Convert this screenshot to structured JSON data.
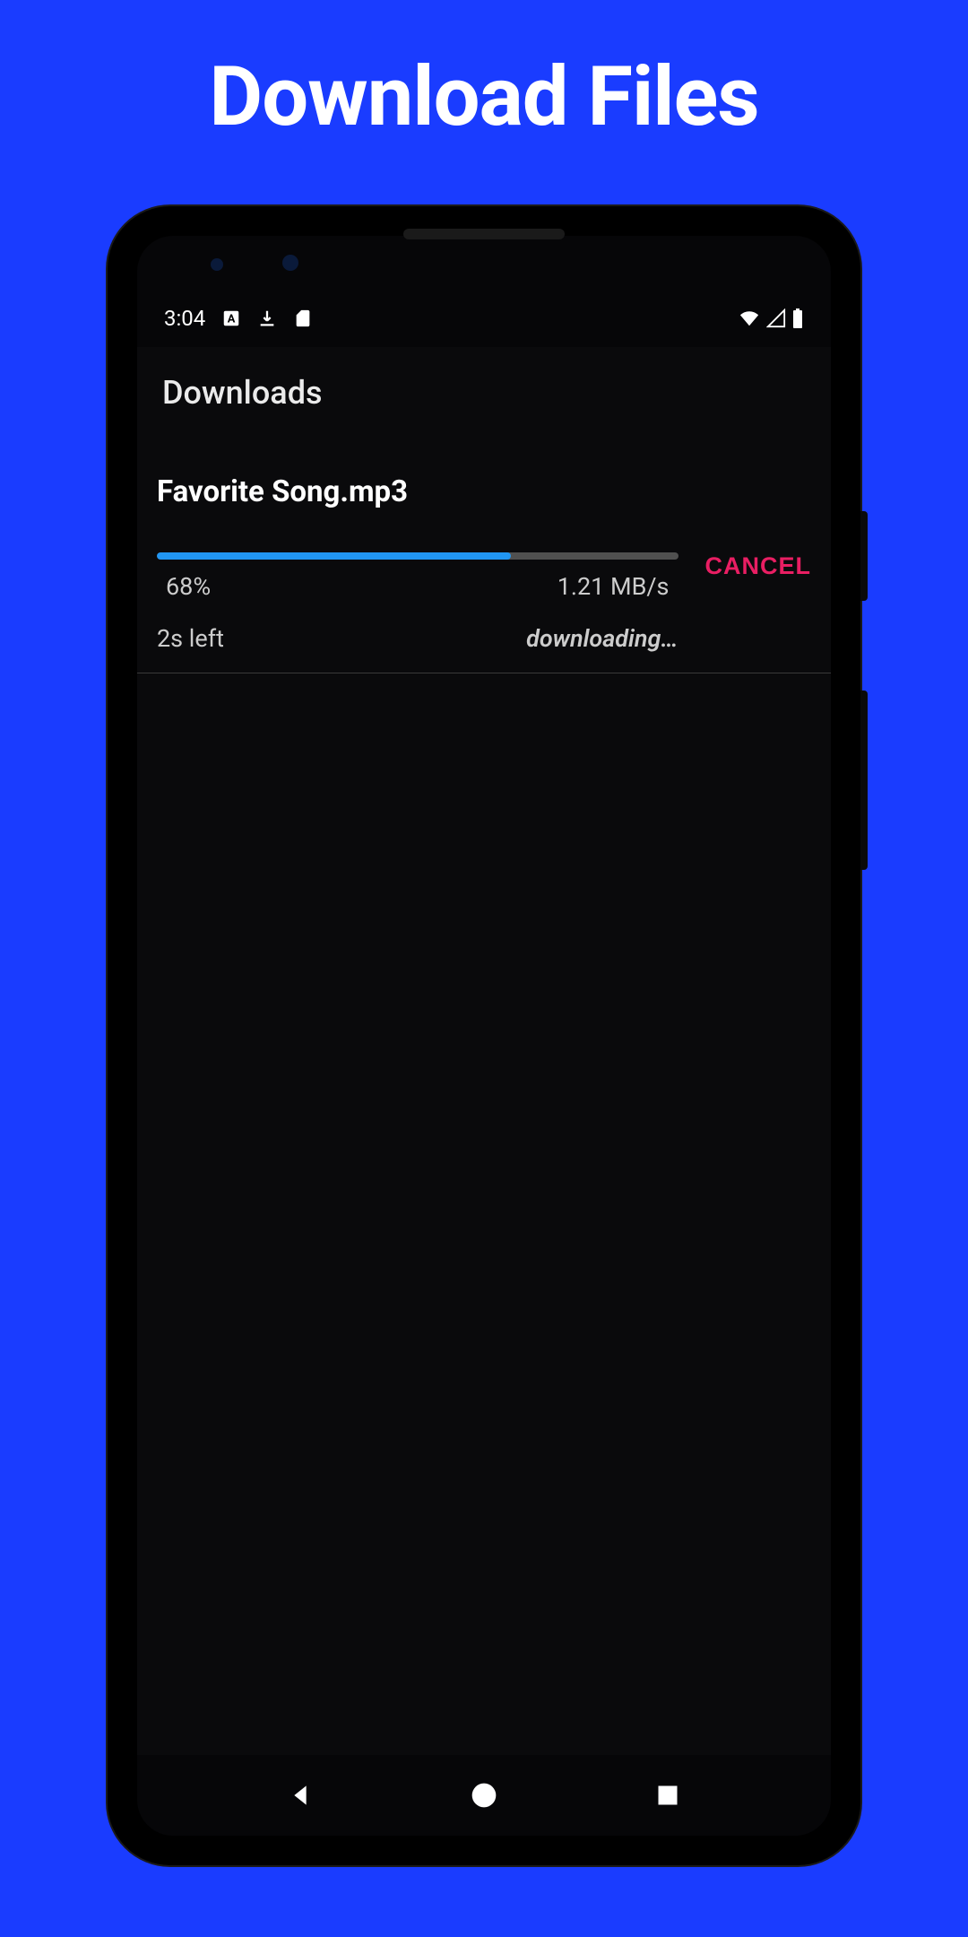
{
  "promo": {
    "title": "Download Files"
  },
  "statusBar": {
    "time": "3:04"
  },
  "app": {
    "title": "Downloads"
  },
  "download": {
    "fileName": "Favorite Song.mp3",
    "progressPercent": 68,
    "progressLabel": "68%",
    "speed": "1.21 MB/s",
    "timeLeft": "2s left",
    "status": "downloading…",
    "cancelLabel": "CANCEL"
  }
}
